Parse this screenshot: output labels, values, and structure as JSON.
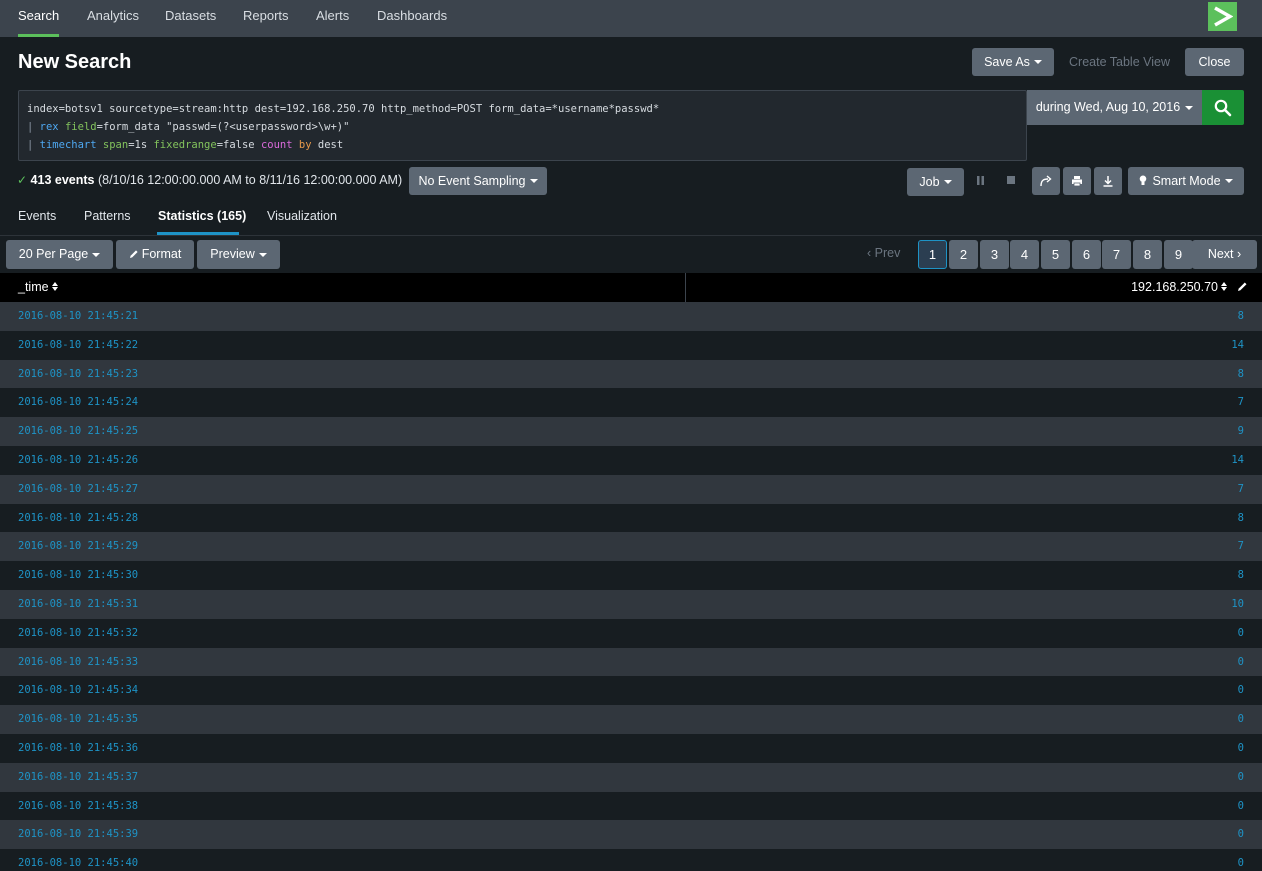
{
  "nav": {
    "items": [
      "Search",
      "Analytics",
      "Datasets",
      "Reports",
      "Alerts",
      "Dashboards"
    ],
    "active": "Search"
  },
  "header": {
    "title": "New Search",
    "save_as": "Save As",
    "create_table_view": "Create Table View",
    "close": "Close"
  },
  "search": {
    "line1": {
      "text": "index=botsv1 sourcetype=stream:http dest=192.168.250.70 http_method=POST form_data=*username*passwd*"
    },
    "line2": {
      "pipe": "| ",
      "cmd": "rex",
      "sp1": " ",
      "arg": "field",
      "rest": "=form_data \"passwd=(?<userpassword>\\w+)\""
    },
    "line3": {
      "pipe": "| ",
      "cmd": "timechart",
      "sp1": " ",
      "arg1": "span",
      "rest1": "=1s ",
      "arg2": "fixedrange",
      "rest2": "=false ",
      "fn": "count",
      "sp2": " ",
      "kw": "by",
      "rest3": " dest"
    },
    "time_range": "during Wed, Aug 10, 2016"
  },
  "status": {
    "check": "✓",
    "count": "413 events",
    "range": "(8/10/16 12:00:00.000 AM to 8/11/16 12:00:00.000 AM)",
    "sampling": "No Event Sampling",
    "job": "Job",
    "mode": "Smart Mode"
  },
  "tabs": [
    "Events",
    "Patterns",
    "Statistics (165)",
    "Visualization"
  ],
  "toolbar": {
    "per_page": "20 Per Page",
    "format": "Format",
    "preview": "Preview",
    "prev": "‹ Prev",
    "pages": [
      "1",
      "2",
      "3",
      "4",
      "5",
      "6",
      "7",
      "8",
      "9"
    ],
    "next": "Next ›"
  },
  "table": {
    "columns": [
      "_time",
      "192.168.250.70"
    ],
    "rows": [
      [
        "2016-08-10 21:45:21",
        "8"
      ],
      [
        "2016-08-10 21:45:22",
        "14"
      ],
      [
        "2016-08-10 21:45:23",
        "8"
      ],
      [
        "2016-08-10 21:45:24",
        "7"
      ],
      [
        "2016-08-10 21:45:25",
        "9"
      ],
      [
        "2016-08-10 21:45:26",
        "14"
      ],
      [
        "2016-08-10 21:45:27",
        "7"
      ],
      [
        "2016-08-10 21:45:28",
        "8"
      ],
      [
        "2016-08-10 21:45:29",
        "7"
      ],
      [
        "2016-08-10 21:45:30",
        "8"
      ],
      [
        "2016-08-10 21:45:31",
        "10"
      ],
      [
        "2016-08-10 21:45:32",
        "0"
      ],
      [
        "2016-08-10 21:45:33",
        "0"
      ],
      [
        "2016-08-10 21:45:34",
        "0"
      ],
      [
        "2016-08-10 21:45:35",
        "0"
      ],
      [
        "2016-08-10 21:45:36",
        "0"
      ],
      [
        "2016-08-10 21:45:37",
        "0"
      ],
      [
        "2016-08-10 21:45:38",
        "0"
      ],
      [
        "2016-08-10 21:45:39",
        "0"
      ],
      [
        "2016-08-10 21:45:40",
        "0"
      ]
    ]
  }
}
